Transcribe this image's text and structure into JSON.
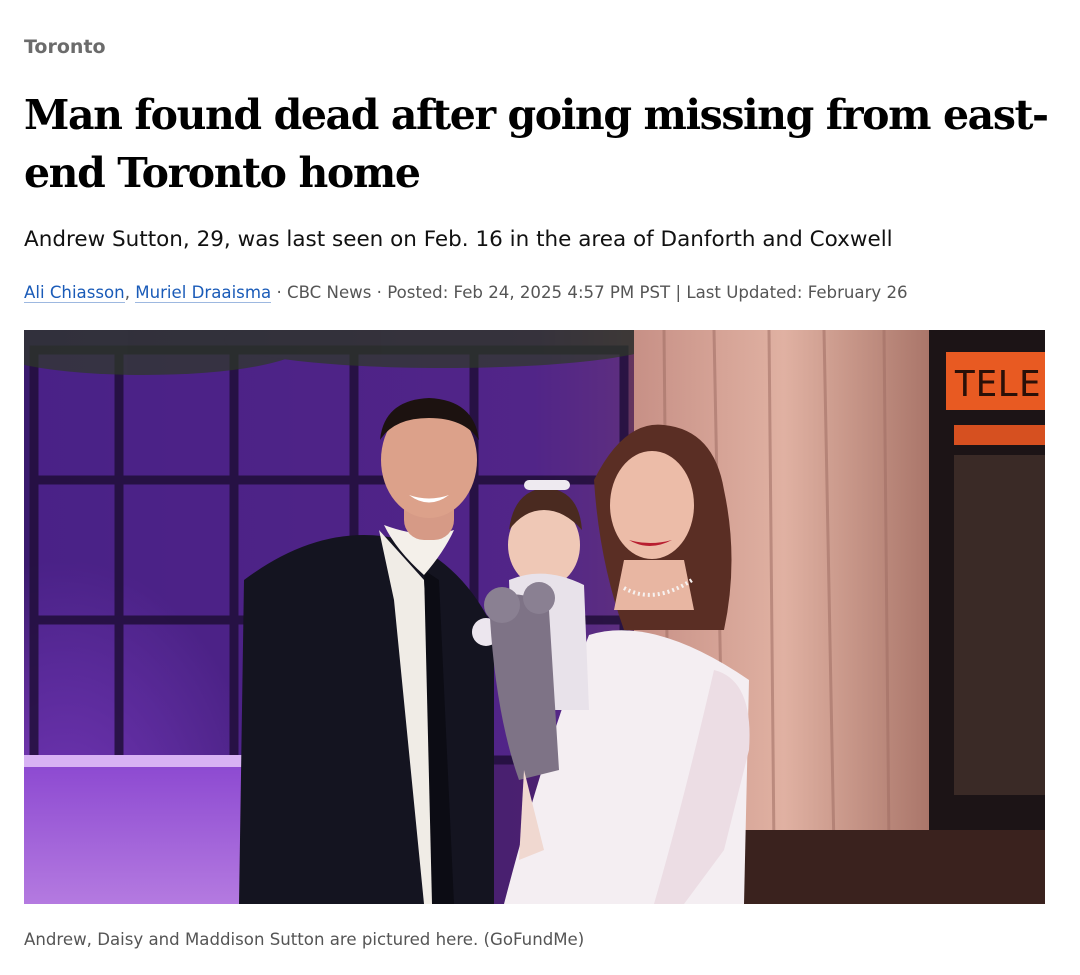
{
  "section": {
    "label": "Toronto"
  },
  "article": {
    "headline": "Man found dead after going missing from east-end Toronto home",
    "deck": "Andrew Sutton, 29, was last seen on Feb. 16 in the area of Danforth and Coxwell",
    "byline": {
      "authors": [
        "Ali Chiasson",
        "Muriel Draaisma"
      ],
      "author_separator": ",",
      "separator": "·",
      "outlet": "CBC News",
      "posted": "Posted: Feb 24, 2025 4:57 PM PST",
      "pipe": "|",
      "updated": "Last Updated: February 26"
    },
    "photo": {
      "sign_text": "TELE",
      "caption": "Andrew, Daisy and Maddison Sutton are pictured here. (GoFundMe)"
    }
  },
  "colors": {
    "link": "#1a5bb8",
    "meta_text": "#555555",
    "section_text": "#6b6b6b"
  }
}
